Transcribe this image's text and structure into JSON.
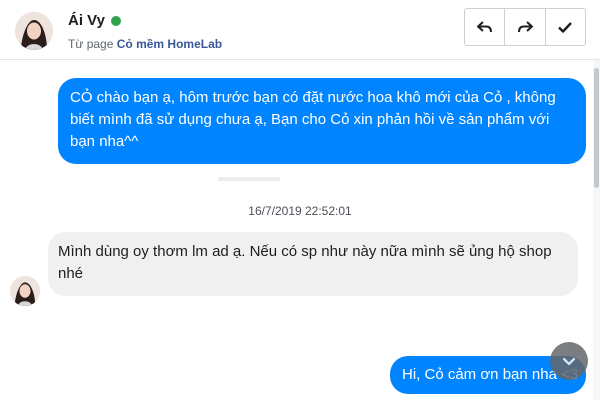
{
  "header": {
    "name": "Ái Vy",
    "page_prefix": "Từ page",
    "page_name": "Cỏ mềm HomeLab",
    "status_color": "#31a24c",
    "actions": [
      {
        "icon": "reply-icon"
      },
      {
        "icon": "forward-icon"
      },
      {
        "icon": "checkmark-icon"
      }
    ]
  },
  "conversation": {
    "messages": [
      {
        "direction": "outgoing",
        "text": "CỎ chào bạn ạ, hôm trước bạn có đặt nước hoa khô mới của Cỏ , không biết mình đã sử dụng chưa ạ, Bạn cho Cỏ xin phản hồi về sản phẩm với bạn nha^^"
      },
      {
        "direction": "incoming",
        "text": "Mình dùng oy thơm lm ad ạ. Nếu có sp như này nữa mình sẽ ủng hộ shop nhé"
      },
      {
        "direction": "outgoing",
        "text": "Hi, Cỏ cảm ơn bạn nha <3"
      }
    ],
    "timestamp": "16/7/2019 22:52:01"
  },
  "colors": {
    "outgoing_bubble": "#0084ff",
    "incoming_bubble": "#f1f0f0",
    "page_link": "#385898"
  },
  "scroll_down_icon": "chevron-down-icon"
}
